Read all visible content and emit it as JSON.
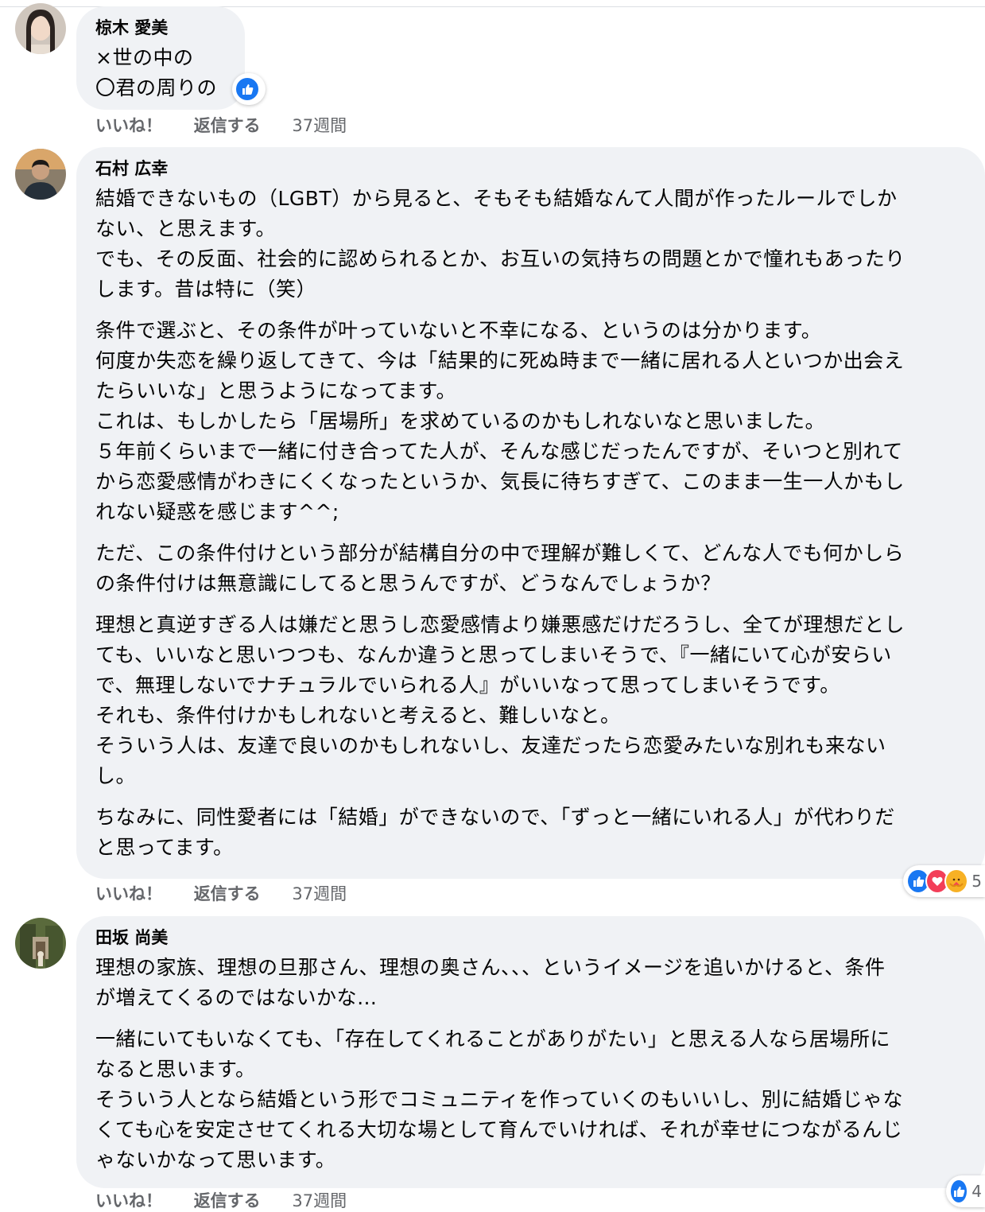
{
  "comments": [
    {
      "author": "椋木 愛美",
      "lines": [
        [
          "×世の中の",
          "〇君の周りの"
        ]
      ],
      "actions": {
        "like": "いいね！",
        "reply": "返信する",
        "time": "37週間"
      },
      "reactions": [
        "like-icon"
      ]
    },
    {
      "author": "石村 広幸",
      "lines": [
        [
          "結婚できないもの（LGBT）から見ると、そもそも結婚なんて人間が作ったルールでしか",
          "ない、と思えます。",
          "でも、その反面、社会的に認められるとか、お互いの気持ちの問題とかで憧れもあったり",
          "します。昔は特に（笑）"
        ],
        [
          "条件で選ぶと、その条件が叶っていないと不幸になる、というのは分かります。",
          "何度か失恋を繰り返してきて、今は「結果的に死ぬ時まで一緒に居れる人といつか出会え",
          "たらいいな」と思うようになってます。",
          "これは、もしかしたら「居場所」を求めているのかもしれないなと思いました。",
          "５年前くらいまで一緒に付き合ってた人が、そんな感じだったんですが、そいつと別れて",
          "から恋愛感情がわきにくくなったというか、気長に待ちすぎて、このまま一生一人かもし",
          "れない疑惑を感じます^^;"
        ],
        [
          "ただ、この条件付けという部分が結構自分の中で理解が難しくて、どんな人でも何かしら",
          "の条件付けは無意識にしてると思うんですが、どうなんでしょうか？"
        ],
        [
          "理想と真逆すぎる人は嫌だと思うし恋愛感情より嫌悪感だけだろうし、全てが理想だとし",
          "ても、いいなと思いつつも、なんか違うと思ってしまいそうで、『一緒にいて心が安らい",
          "で、無理しないでナチュラルでいられる人』がいいなって思ってしまいそうです。",
          "それも、条件付けかもしれないと考えると、難しいなと。",
          "そういう人は、友達で良いのかもしれないし、友達だったら恋愛みたいな別れも来ない",
          "し。"
        ],
        [
          "ちなみに、同性愛者には「結婚」ができないので、「ずっと一緒にいれる人」が代わりだ",
          "と思ってます。"
        ]
      ],
      "actions": {
        "like": "いいね！",
        "reply": "返信する",
        "time": "37週間"
      },
      "reactions": [
        "like-icon",
        "heart-icon",
        "care-icon"
      ],
      "reaction_count": "5"
    },
    {
      "author": "田坂 尚美",
      "lines": [
        [
          "理想の家族、理想の旦那さん、理想の奥さん、、、というイメージを追いかけると、条件",
          "が増えてくるのではないかな…"
        ],
        [
          "一緒にいてもいなくても、「存在してくれることがありがたい」と思える人なら居場所に",
          "なると思います。",
          "そういう人となら結婚という形でコミュニティを作っていくのもいいし、別に結婚じゃな",
          "くても心を安定させてくれる大切な場として育んでいければ、それが幸せにつながるんじ",
          "ゃないかなって思います。"
        ]
      ],
      "actions": {
        "like": "いいね！",
        "reply": "返信する",
        "time": "37週間"
      },
      "reactions": [
        "like-icon"
      ],
      "reaction_count": "4"
    }
  ],
  "colors": {
    "bubble": "#f0f2f5",
    "like_blue": "#1877f2",
    "heart_red": "#f33e58",
    "care_yellow": "#f7b125",
    "meta_gray": "#65676b"
  }
}
